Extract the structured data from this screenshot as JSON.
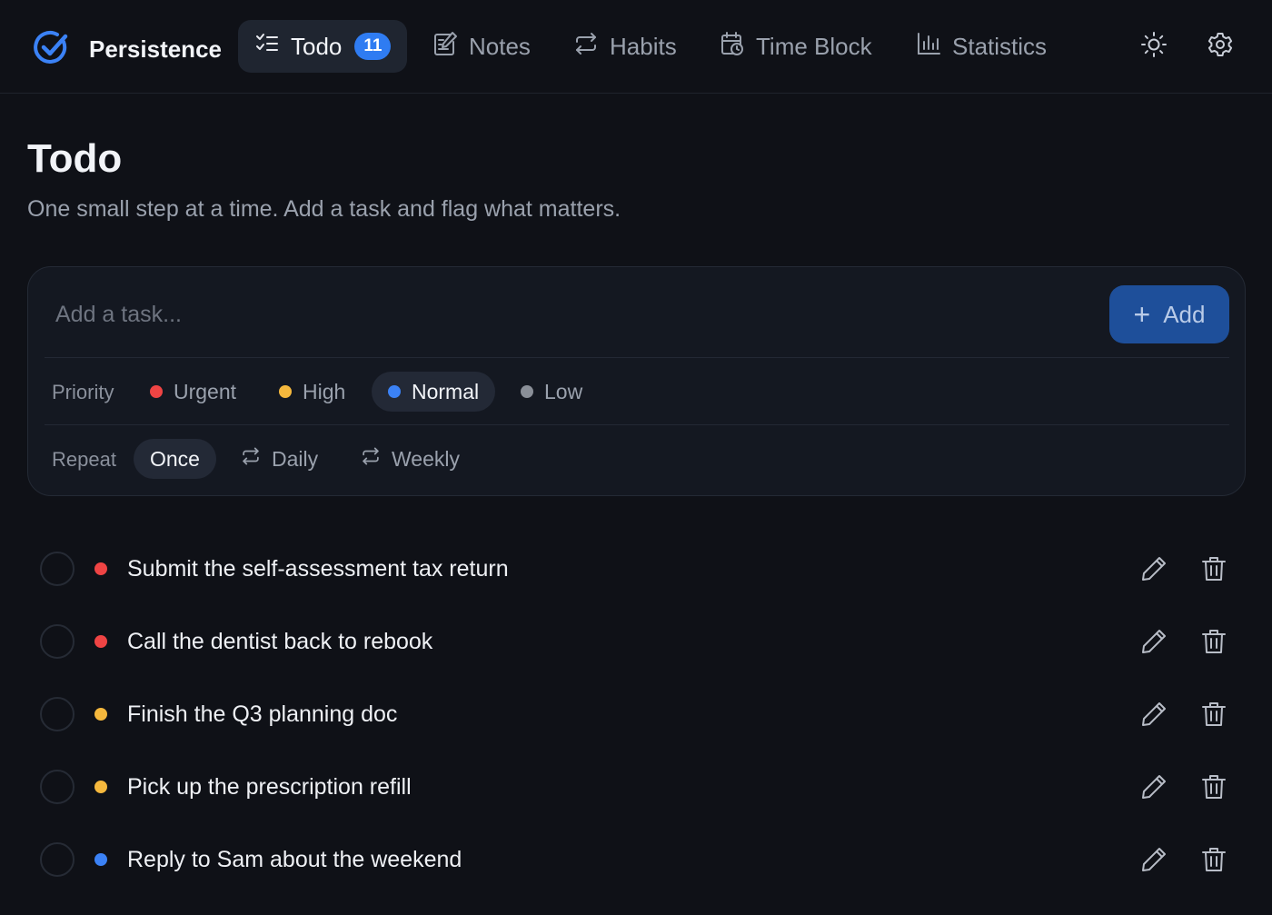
{
  "app": {
    "name": "Persistence"
  },
  "nav": {
    "items": [
      {
        "label": "Todo",
        "icon": "list-check-icon",
        "badge": "11",
        "active": true
      },
      {
        "label": "Notes",
        "icon": "note-edit-icon"
      },
      {
        "label": "Habits",
        "icon": "repeat-icon"
      },
      {
        "label": "Time Block",
        "icon": "calendar-clock-icon"
      },
      {
        "label": "Statistics",
        "icon": "bar-chart-icon"
      }
    ],
    "actions": [
      "sun-icon",
      "gear-icon"
    ]
  },
  "page": {
    "title": "Todo",
    "subtitle": "One small step at a time. Add a task and flag what matters."
  },
  "composer": {
    "placeholder": "Add a task...",
    "value": "",
    "add_label": "Add",
    "priority_label": "Priority",
    "priorities": [
      {
        "label": "Urgent",
        "color": "#ef4444",
        "selected": false
      },
      {
        "label": "High",
        "color": "#f5b83d",
        "selected": false
      },
      {
        "label": "Normal",
        "color": "#3b82f6",
        "selected": true
      },
      {
        "label": "Low",
        "color": "#8a8f98",
        "selected": false
      }
    ],
    "repeat_label": "Repeat",
    "repeats": [
      {
        "label": "Once",
        "selected": true
      },
      {
        "label": "Daily",
        "icon": "repeat-icon",
        "selected": false
      },
      {
        "label": "Weekly",
        "icon": "repeat-icon",
        "selected": false
      }
    ]
  },
  "tasks": [
    {
      "text": "Submit the self-assessment tax return",
      "priority_color": "#ef4444"
    },
    {
      "text": "Call the dentist back to rebook",
      "priority_color": "#ef4444"
    },
    {
      "text": "Finish the Q3 planning doc",
      "priority_color": "#f5b83d"
    },
    {
      "text": "Pick up the prescription refill",
      "priority_color": "#f5b83d"
    },
    {
      "text": "Reply to Sam about the weekend",
      "priority_color": "#3b82f6"
    }
  ],
  "colors": {
    "accent": "#2f7cf2",
    "background": "#0f1117"
  }
}
